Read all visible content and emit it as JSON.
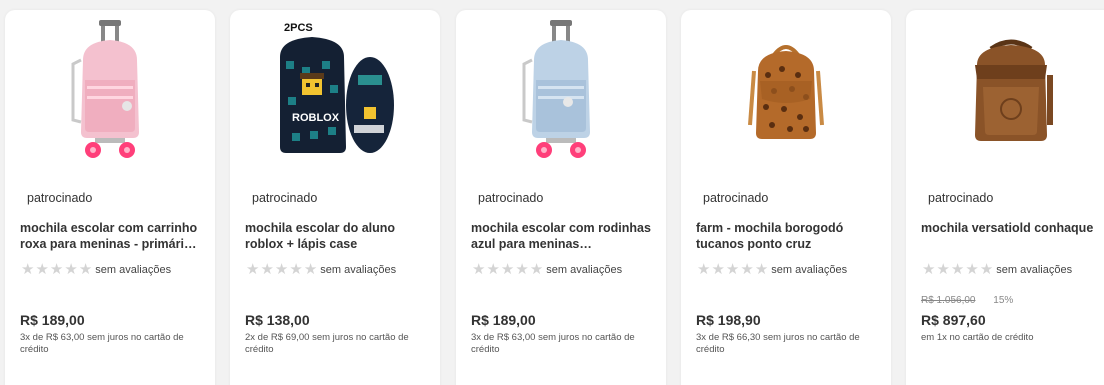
{
  "products": [
    {
      "sponsored": "patrocinado",
      "name": "mochila escolar com carrinho roxa para meninas - primári…",
      "rating_label": "sem avaliações",
      "price": "R$ 189,00",
      "installments": "3x de R$ 63,00 sem juros no cartão de crédito",
      "image_icon": "pink-trolley-backpack-icon"
    },
    {
      "sponsored": "patrocinado",
      "name": "mochila escolar do aluno roblox + lápis case",
      "rating_label": "sem avaliações",
      "price": "R$ 138,00",
      "installments": "2x de R$ 69,00 sem juros no cartão de crédito",
      "image_icon": "roblox-backpack-icon",
      "image_badge": "2PCS",
      "image_brand": "ROBLOX"
    },
    {
      "sponsored": "patrocinado",
      "name": "mochila escolar com rodinhas azul para meninas…",
      "rating_label": "sem avaliações",
      "price": "R$ 189,00",
      "installments": "3x de R$ 63,00 sem juros no cartão de crédito",
      "image_icon": "blue-trolley-backpack-icon"
    },
    {
      "sponsored": "patrocinado",
      "name": "farm - mochila borogodó tucanos ponto cruz",
      "rating_label": "sem avaliações",
      "price": "R$ 198,90",
      "installments": "3x de R$ 66,30 sem juros no cartão de crédito",
      "image_icon": "leopard-backpack-icon"
    },
    {
      "sponsored": "patrocinado",
      "name": "mochila versatiold conhaque",
      "rating_label": "sem avaliações",
      "old_price": "R$ 1.056,00",
      "discount": "15%",
      "price": "R$ 897,60",
      "installments": "em 1x no cartão de crédito",
      "image_icon": "leather-backpack-icon"
    }
  ],
  "colors": {
    "card_bg": "#ffffff",
    "page_bg": "#f2f2f2",
    "star_empty": "#d4d4d4",
    "text": "#333333"
  }
}
